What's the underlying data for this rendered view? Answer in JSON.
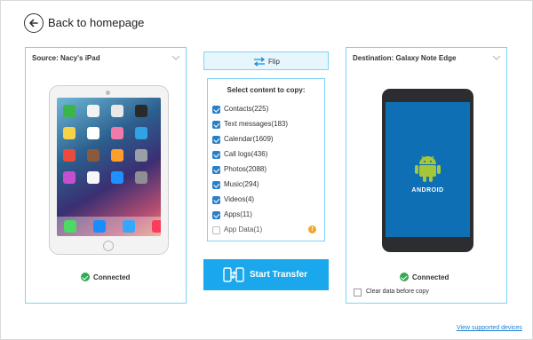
{
  "header": {
    "back_label": "Back to homepage"
  },
  "source": {
    "title": "Source: Nacy's iPad",
    "device_type": "iPad",
    "status": "Connected"
  },
  "destination": {
    "title": "Destination: Galaxy Note Edge",
    "device_type": "Android",
    "android_label": "ANDROID",
    "status": "Connected",
    "clear_data_label": "Clear data before copy",
    "clear_data_checked": false
  },
  "flip": {
    "label": "Flip"
  },
  "content": {
    "title": "Select content to copy:",
    "items": [
      {
        "label": "Contacts(225)",
        "checked": true
      },
      {
        "label": "Text messages(183)",
        "checked": true
      },
      {
        "label": "Calendar(1609)",
        "checked": true
      },
      {
        "label": "Call logs(436)",
        "checked": true
      },
      {
        "label": "Photos(2088)",
        "checked": true
      },
      {
        "label": "Music(294)",
        "checked": true
      },
      {
        "label": "Videos(4)",
        "checked": true
      },
      {
        "label": "Apps(11)",
        "checked": true
      },
      {
        "label": "App Data(1)",
        "checked": false
      }
    ]
  },
  "start_transfer": {
    "label": "Start Transfer"
  },
  "footer": {
    "supported_link": "View supported devices"
  },
  "colors": {
    "accent": "#1aa7ec",
    "panel_border": "#7fd3f5",
    "checkbox": "#2a7fc9",
    "connected": "#34a853",
    "info": "#f5a623",
    "android_screen": "#0f6fb5",
    "android_green": "#a4c639"
  }
}
